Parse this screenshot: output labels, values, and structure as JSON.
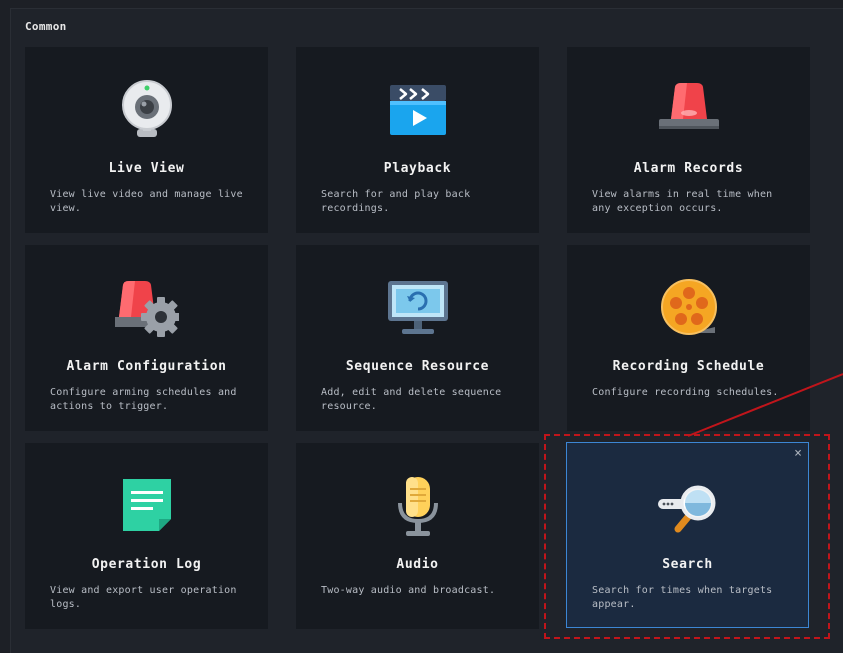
{
  "section": {
    "title": "Common"
  },
  "cards": [
    {
      "title": "Live View",
      "desc": "View live video and manage live view.",
      "icon": "webcam-icon"
    },
    {
      "title": "Playback",
      "desc": "Search for and play back recordings.",
      "icon": "clapperboard-play-icon"
    },
    {
      "title": "Alarm Records",
      "desc": "View alarms in real time when any exception occurs.",
      "icon": "alarm-light-icon"
    },
    {
      "title": "Alarm Configuration",
      "desc": "Configure arming schedules and actions to trigger.",
      "icon": "alarm-gear-icon"
    },
    {
      "title": "Sequence Resource",
      "desc": "Add, edit and delete sequence resource.",
      "icon": "monitor-refresh-icon"
    },
    {
      "title": "Recording Schedule",
      "desc": "Configure recording schedules.",
      "icon": "film-reel-icon"
    },
    {
      "title": "Operation Log",
      "desc": "View and export user operation logs.",
      "icon": "document-log-icon"
    },
    {
      "title": "Audio",
      "desc": "Two-way audio and broadcast.",
      "icon": "microphone-icon"
    },
    {
      "title": "Search",
      "desc": "Search for times when targets appear.",
      "icon": "magnifier-search-icon",
      "selected": true,
      "close": "×"
    }
  ],
  "colors": {
    "accent": "#3c86d4",
    "annotation": "#c0151b",
    "card_bg": "#161a20",
    "selected_bg": "#1b2a40"
  }
}
